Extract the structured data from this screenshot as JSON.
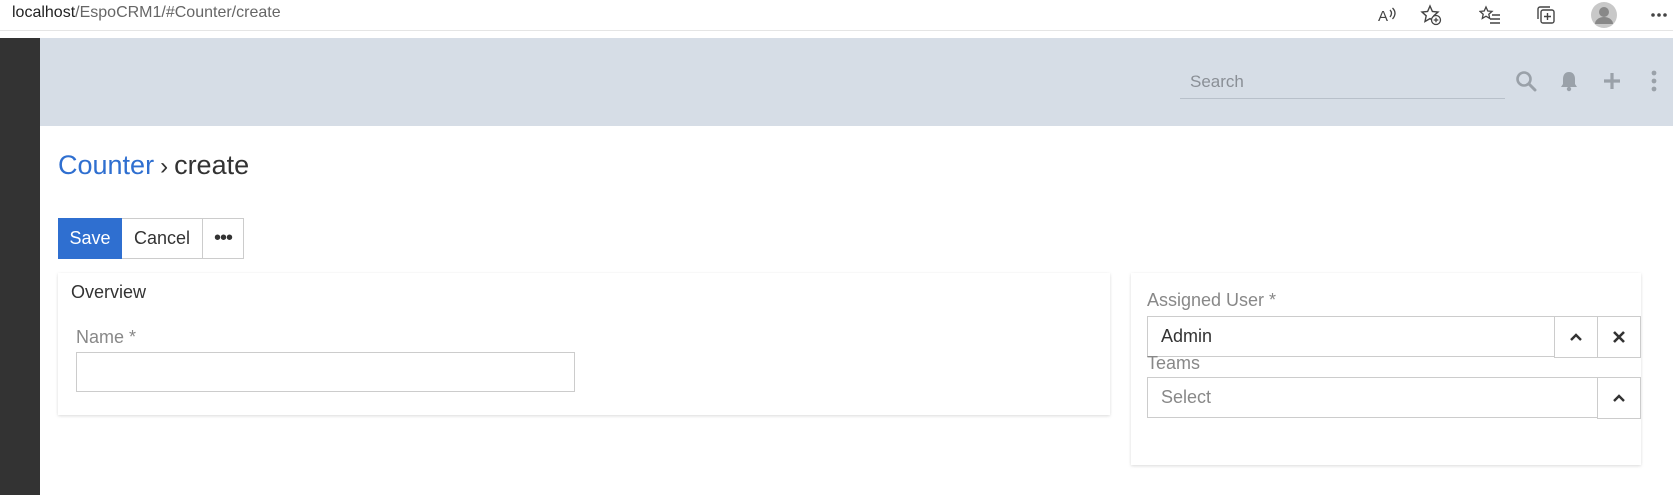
{
  "browser": {
    "url_host": "localhost",
    "url_path": "/EspoCRM1/#Counter/create",
    "icons": [
      "read-aloud-icon",
      "favorite-add-icon",
      "favorites-icon",
      "collections-icon",
      "profile-icon",
      "more-icon"
    ]
  },
  "header": {
    "search_placeholder": "Search",
    "icons": [
      "search-icon",
      "bell-icon",
      "plus-icon",
      "kebab-menu-icon"
    ]
  },
  "breadcrumb": {
    "entity": "Counter",
    "separator": "›",
    "current": "create"
  },
  "toolbar": {
    "save_label": "Save",
    "cancel_label": "Cancel",
    "more_label": "•••"
  },
  "main_panel": {
    "title": "Overview",
    "name_label": "Name *",
    "name_value": ""
  },
  "side_panel": {
    "assigned_user_label": "Assigned User *",
    "assigned_user_value": "Admin",
    "teams_label": "Teams",
    "teams_placeholder": "Select"
  },
  "colors": {
    "accent": "#2f6fd0",
    "header_bg": "#d6dde6",
    "sidebar_bg": "#333333"
  }
}
